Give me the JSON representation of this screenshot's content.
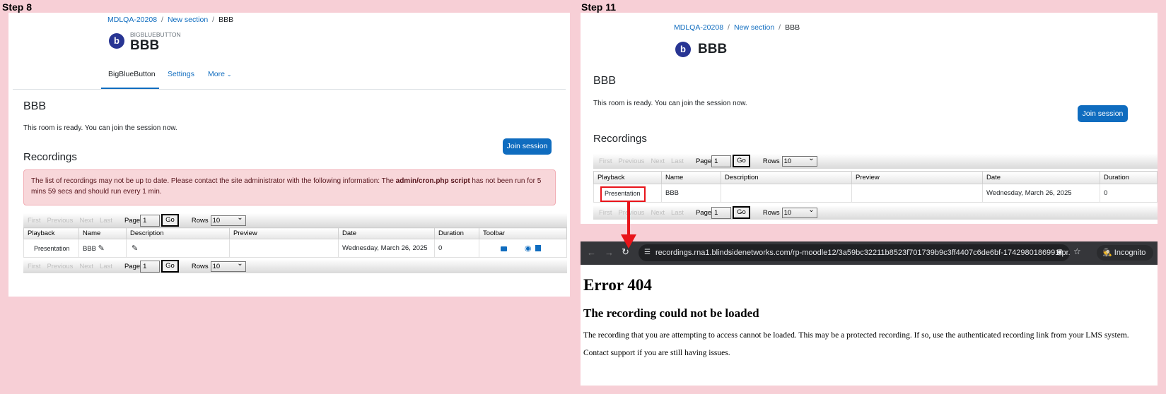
{
  "step8": {
    "label": "Step 8",
    "breadcrumb": [
      "MDLQA-20208",
      "New section",
      "BBB"
    ],
    "module_type": "BIGBLUEBUTTON",
    "title": "BBB",
    "icon": "bigbluebutton-icon",
    "tabs": [
      "BigBlueButton",
      "Settings",
      "More"
    ],
    "room_title": "BBB",
    "room_status": "This room is ready. You can join the session now.",
    "join_button": "Join session",
    "recordings_heading": "Recordings",
    "alert_prefix": "The list of recordings may not be up to date. Please contact the site administrator with the following information: The ",
    "alert_bold": "admin/cron.php script",
    "alert_suffix": " has not been run for 5 mins 59 secs and should run every 1 min.",
    "pager": {
      "first": "First",
      "previous": "Previous",
      "next": "Next",
      "last": "Last",
      "page_label": "Page",
      "page_value": "1",
      "go": "Go",
      "rows_label": "Rows",
      "rows_value": "10"
    },
    "columns": [
      "Playback",
      "Name",
      "Description",
      "Preview",
      "Date",
      "Duration",
      "Toolbar"
    ],
    "row": {
      "playback": "Presentation",
      "name": "BBB",
      "description": "",
      "preview": "",
      "date": "Wednesday, March 26, 2025",
      "duration": "0"
    }
  },
  "step11": {
    "label": "Step 11",
    "breadcrumb": [
      "MDLQA-20208",
      "New section",
      "BBB"
    ],
    "title": "BBB",
    "room_title": "BBB",
    "room_status": "This room is ready. You can join the session now.",
    "join_button": "Join session",
    "recordings_heading": "Recordings",
    "pager": {
      "first": "First",
      "previous": "Previous",
      "next": "Next",
      "last": "Last",
      "page_label": "Page",
      "page_value": "1",
      "go": "Go",
      "rows_label": "Rows",
      "rows_value": "10"
    },
    "columns": [
      "Playback",
      "Name",
      "Description",
      "Preview",
      "Date",
      "Duration"
    ],
    "row": {
      "playback": "Presentation",
      "name": "BBB",
      "description": "",
      "preview": "",
      "date": "Wednesday, March 26, 2025",
      "duration": "0"
    }
  },
  "browser": {
    "url": "recordings.rna1.blindsidenetworks.com/rp-moodle12/3a59bc32211b8523f701739b9c3ff4407c6de6bf-1742980186991/pr...",
    "incognito_label": "Incognito"
  },
  "error_page": {
    "code": "Error 404",
    "heading": "The recording could not be loaded",
    "message": "The recording that you are attempting to access cannot be loaded. This may be a protected recording. If so, use the authenticated recording link from your LMS system.",
    "support": "Contact support if you are still having issues."
  },
  "colors": {
    "background": "#f7cfd6",
    "link": "#0f6cbf",
    "highlight": "#e8141a",
    "alert_bg": "#f8d7da",
    "bbb_icon": "#283593"
  }
}
